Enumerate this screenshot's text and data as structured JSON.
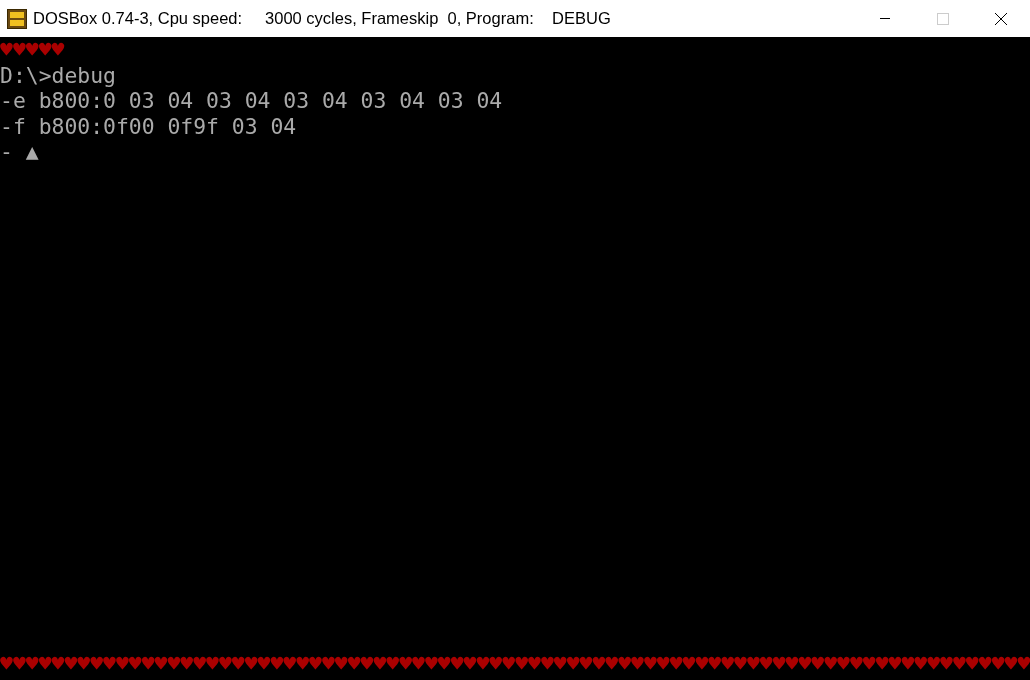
{
  "window": {
    "title": "DOSBox 0.74-3, Cpu speed:     3000 cycles, Frameskip  0, Program:    DEBUG",
    "maximize_disabled": true
  },
  "screen": {
    "lines": [
      {
        "text": "♥♥♥♥♥",
        "color": "#aa0000",
        "kind": "top"
      },
      {
        "text": "D:\\>debug",
        "color": "#aaaaaa",
        "kind": "top"
      },
      {
        "text": "-e b800:0 03 04 03 04 03 04 03 04 03 04",
        "color": "#aaaaaa",
        "kind": "top"
      },
      {
        "text": "-f b800:0f00 0f9f 03 04",
        "color": "#aaaaaa",
        "kind": "top"
      },
      {
        "text": "- ▲",
        "color": "#aaaaaa",
        "kind": "top"
      },
      {
        "text": "♥♥♥♥♥♥♥♥♥♥♥♥♥♥♥♥♥♥♥♥♥♥♥♥♥♥♥♥♥♥♥♥♥♥♥♥♥♥♥♥♥♥♥♥♥♥♥♥♥♥♥♥♥♥♥♥♥♥♥♥♥♥♥♥♥♥♥♥♥♥♥♥♥♥♥♥♥♥♥♥",
        "color": "#aa0000",
        "kind": "bottom"
      }
    ]
  }
}
